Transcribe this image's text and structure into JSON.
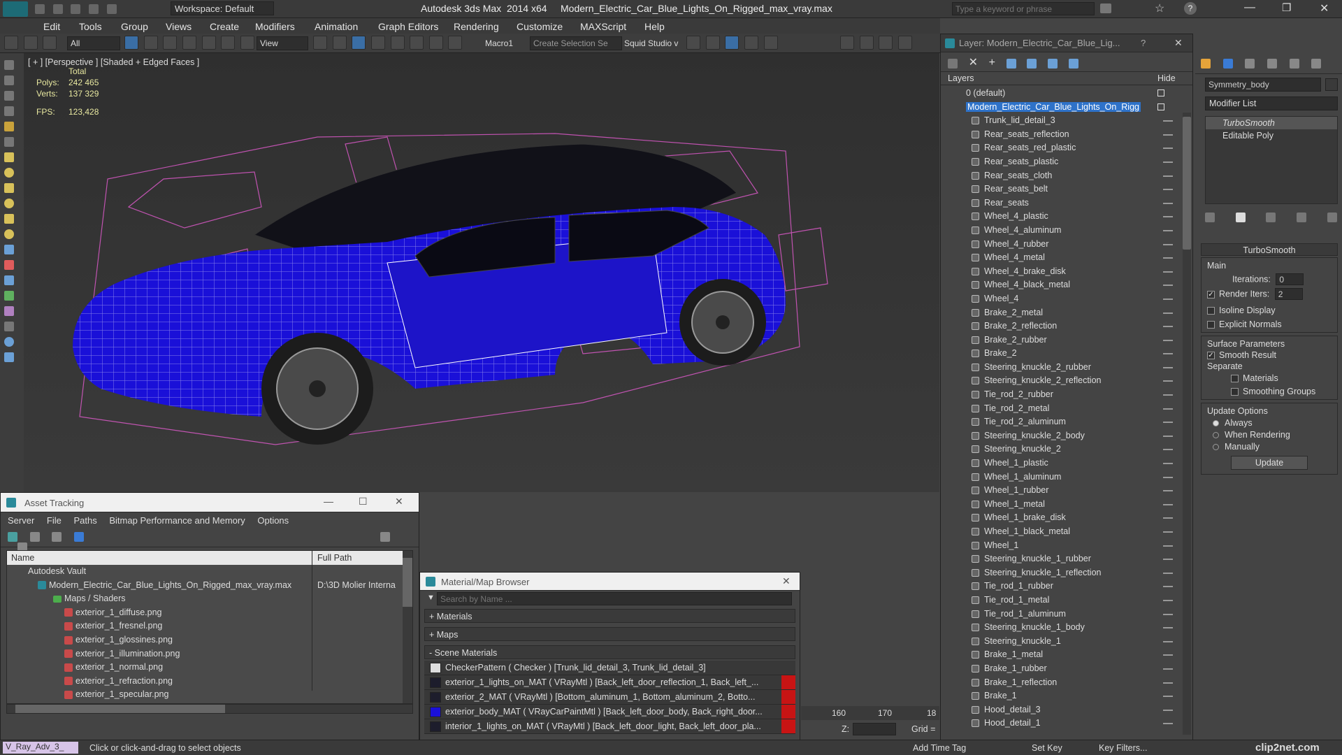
{
  "window": {
    "title": "Autodesk 3ds Max  2014 x64     Modern_Electric_Car_Blue_Lights_On_Rigged_max_vray.max",
    "workspace": "Workspace: Default",
    "search_placeholder": "Type a keyword or phrase"
  },
  "menu": [
    "Edit",
    "Tools",
    "Group",
    "Views",
    "Create",
    "Modifiers",
    "Animation",
    "Graph Editors",
    "Rendering",
    "Customize",
    "MAXScript",
    "Help"
  ],
  "toolbar": {
    "selection_filter": "All",
    "ref_coord": "View",
    "macro_label": "Macro1",
    "selection_set_placeholder": "Create Selection Se",
    "squid_studio": "Squid Studio v"
  },
  "viewport": {
    "label": "[ + ] [Perspective ] [Shaded + Edged Faces ]",
    "stats": {
      "total_label": "Total",
      "polys_label": "Polys:",
      "polys_value": "242 465",
      "verts_label": "Verts:",
      "verts_value": "137 329",
      "fps_label": "FPS:",
      "fps_value": "123,428"
    }
  },
  "layer_dialog": {
    "title": "Layer: Modern_Electric_Car_Blue_Lig...",
    "help": "?",
    "col_layers": "Layers",
    "col_hide": "Hide",
    "root_default": "0 (default)",
    "selected_layer": "Modern_Electric_Car_Blue_Lights_On_Rigg",
    "items": [
      "Trunk_lid_detail_3",
      "Rear_seats_reflection",
      "Rear_seats_red_plastic",
      "Rear_seats_plastic",
      "Rear_seats_cloth",
      "Rear_seats_belt",
      "Rear_seats",
      "Wheel_4_plastic",
      "Wheel_4_aluminum",
      "Wheel_4_rubber",
      "Wheel_4_metal",
      "Wheel_4_brake_disk",
      "Wheel_4_black_metal",
      "Wheel_4",
      "Brake_2_metal",
      "Brake_2_reflection",
      "Brake_2_rubber",
      "Brake_2",
      "Steering_knuckle_2_rubber",
      "Steering_knuckle_2_reflection",
      "Tie_rod_2_rubber",
      "Tie_rod_2_metal",
      "Tie_rod_2_aluminum",
      "Steering_knuckle_2_body",
      "Steering_knuckle_2",
      "Wheel_1_plastic",
      "Wheel_1_aluminum",
      "Wheel_1_rubber",
      "Wheel_1_metal",
      "Wheel_1_brake_disk",
      "Wheel_1_black_metal",
      "Wheel_1",
      "Steering_knuckle_1_rubber",
      "Steering_knuckle_1_reflection",
      "Tie_rod_1_rubber",
      "Tie_rod_1_metal",
      "Tie_rod_1_aluminum",
      "Steering_knuckle_1_body",
      "Steering_knuckle_1",
      "Brake_1_metal",
      "Brake_1_rubber",
      "Brake_1_reflection",
      "Brake_1",
      "Hood_detail_3",
      "Hood_detail_1"
    ]
  },
  "command_panel": {
    "object_name": "Symmetry_body",
    "modifier_list": "Modifier List",
    "stack": [
      "TurboSmooth",
      "Editable Poly"
    ],
    "turbosmooth": {
      "title": "TurboSmooth",
      "main": "Main",
      "iterations_label": "Iterations:",
      "iterations_value": "0",
      "render_iters_label": "Render Iters:",
      "render_iters_value": "2",
      "isoline": "Isoline Display",
      "explicit_normals": "Explicit Normals",
      "surface_params": "Surface Parameters",
      "smooth_result": "Smooth Result",
      "separate": "Separate",
      "materials": "Materials",
      "smoothing_groups": "Smoothing Groups",
      "update_options": "Update Options",
      "always": "Always",
      "when_rendering": "When Rendering",
      "manually": "Manually",
      "update_button": "Update"
    }
  },
  "asset_tracking": {
    "title": "Asset Tracking",
    "menu": [
      "Server",
      "File",
      "Paths",
      "Bitmap Performance and Memory",
      "Options"
    ],
    "col_name": "Name",
    "col_path": "Full Path",
    "vault": "Autodesk Vault",
    "file": "Modern_Electric_Car_Blue_Lights_On_Rigged_max_vray.max",
    "file_path": "D:\\3D Molier Interna",
    "maps_folder": "Maps / Shaders",
    "maps": [
      "exterior_1_diffuse.png",
      "exterior_1_fresnel.png",
      "exterior_1_glossines.png",
      "exterior_1_illumination.png",
      "exterior_1_normal.png",
      "exterior_1_refraction.png",
      "exterior_1_specular.png"
    ]
  },
  "material_browser": {
    "title": "Material/Map Browser",
    "search_placeholder": "Search by Name ...",
    "groups": [
      "+ Materials",
      "+ Maps",
      "- Scene Materials"
    ],
    "items": [
      "CheckerPattern  ( Checker )  [Trunk_lid_detail_3, Trunk_lid_detail_3]",
      "exterior_1_lights_on_MAT  ( VRayMtl )  [Back_left_door_reflection_1, Back_left_...",
      "exterior_2_MAT  ( VRayMtl )  [Bottom_aluminum_1, Bottom_aluminum_2, Botto...",
      "exterior_body_MAT  ( VRayCarPaintMtl )  [Back_left_door_body, Back_right_door...",
      "interior_1_lights_on_MAT  ( VRayMtl )  [Back_left_door_light, Back_left_door_pla..."
    ]
  },
  "timeline": {
    "tick_160": "160",
    "tick_170": "170",
    "tick_18": "18",
    "z_label": "Z:",
    "grid_label": "Grid ="
  },
  "status": {
    "script_label": "V_Ray_Adv_3_",
    "prompt": "Click or click-and-drag to select objects",
    "add_time_tag": "Add Time Tag",
    "set_key": "Set Key",
    "key_filters": "Key Filters...",
    "watermark": "clip2net.com"
  },
  "colors": {
    "accent": "#3a7bd5",
    "car_blue": "#1a10d8",
    "wire_pink": "#e45bd0"
  }
}
